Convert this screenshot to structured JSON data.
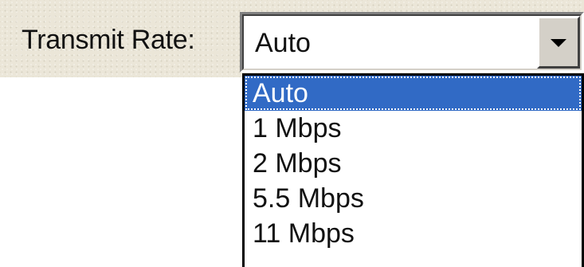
{
  "form": {
    "label": "Transmit Rate:"
  },
  "combo": {
    "selected": "Auto",
    "dropdown_icon": "chevron-down-icon"
  },
  "dropdown": {
    "options": [
      {
        "label": "Auto",
        "selected": true
      },
      {
        "label": "1 Mbps",
        "selected": false
      },
      {
        "label": "2 Mbps",
        "selected": false
      },
      {
        "label": "5.5 Mbps",
        "selected": false
      },
      {
        "label": "11 Mbps",
        "selected": false
      }
    ]
  },
  "colors": {
    "panel": "#ebe6d8",
    "selection": "#316ac5",
    "selection_text": "#ffffff",
    "text": "#111111"
  }
}
